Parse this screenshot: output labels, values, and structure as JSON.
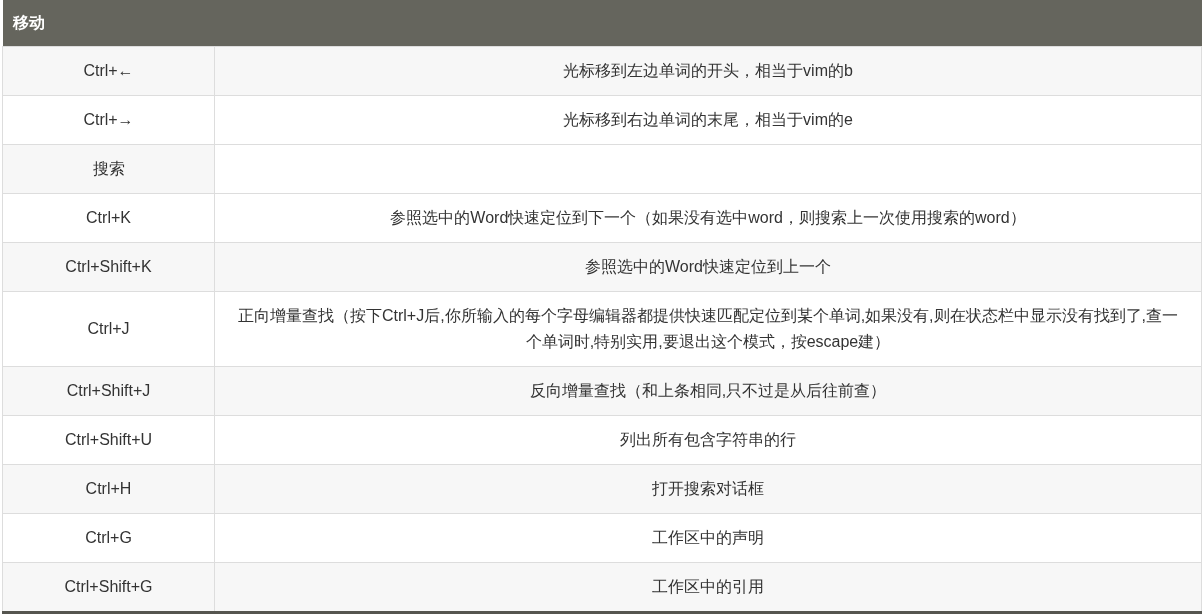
{
  "table": {
    "header": "移动",
    "rows": [
      {
        "key": "Ctrl+←",
        "description": "光标移到左边单词的开头，相当于vim的b"
      },
      {
        "key": "Ctrl+→",
        "description": "光标移到右边单词的末尾，相当于vim的e"
      },
      {
        "key": "搜索"
      },
      {
        "key": "Ctrl+K",
        "description": "参照选中的Word快速定位到下一个（如果没有选中word，则搜索上一次使用搜索的word）"
      },
      {
        "key": "Ctrl+Shift+K",
        "description": "参照选中的Word快速定位到上一个"
      },
      {
        "key": "Ctrl+J",
        "description": "正向增量查找（按下Ctrl+J后,你所输入的每个字母编辑器都提供快速匹配定位到某个单词,如果没有,则在状态栏中显示没有找到了,查一个单词时,特别实用,要退出这个模式，按escape建）"
      },
      {
        "key": "Ctrl+Shift+J",
        "description": "反向增量查找（和上条相同,只不过是从后往前查）"
      },
      {
        "key": "Ctrl+Shift+U",
        "description": "列出所有包含字符串的行"
      },
      {
        "key": "Ctrl+H",
        "description": "打开搜索对话框"
      },
      {
        "key": "Ctrl+G",
        "description": "工作区中的声明"
      },
      {
        "key": "Ctrl+Shift+G",
        "description": "工作区中的引用"
      }
    ]
  }
}
